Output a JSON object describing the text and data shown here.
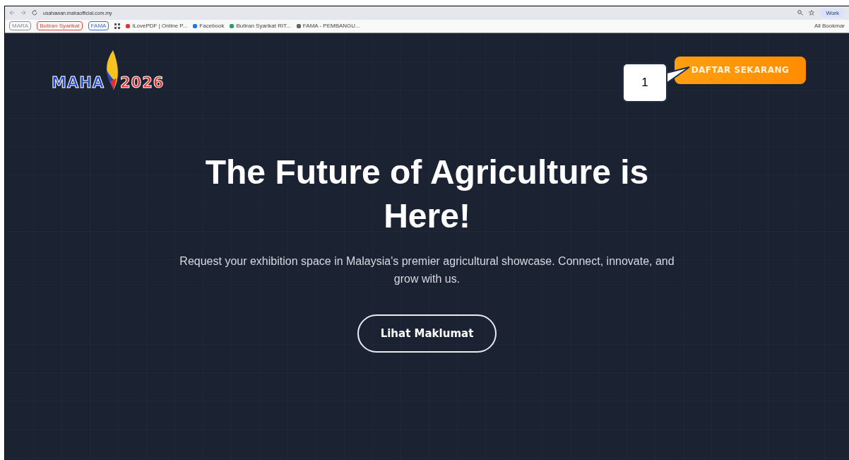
{
  "browser": {
    "url": "usahawan.mahaofficial.com.my",
    "profile": "Work",
    "bookmarks": [
      {
        "kind": "chip",
        "label": "MARA",
        "color": "#8a8f98"
      },
      {
        "kind": "chip",
        "label": "Butiran Syarikat",
        "color": "#d9453b"
      },
      {
        "kind": "chip",
        "label": "FAMA",
        "color": "#3b6fd9"
      },
      {
        "kind": "apps"
      },
      {
        "kind": "link",
        "label": "iLovePDF | Online P...",
        "color": "#e5322d"
      },
      {
        "kind": "link",
        "label": "Facebook",
        "color": "#1877f2"
      },
      {
        "kind": "link",
        "label": "Butiran Syarikat RIT...",
        "color": "#1fa463"
      },
      {
        "kind": "link",
        "label": "FAMA - PEMBANGU...",
        "color": "#5f6368"
      }
    ],
    "all_bookmarks": "All Bookmar"
  },
  "site": {
    "logo": {
      "word": "MAHA",
      "year": "2026"
    },
    "cta": "DAFTAR SEKARANG",
    "headline": "The Future of Agriculture is Here!",
    "subtitle": "Request your exhibition space in Malaysia's premier agricultural showcase. Connect, innovate, and grow with us.",
    "button": "Lihat Maklumat"
  },
  "callout": {
    "label": "1"
  }
}
